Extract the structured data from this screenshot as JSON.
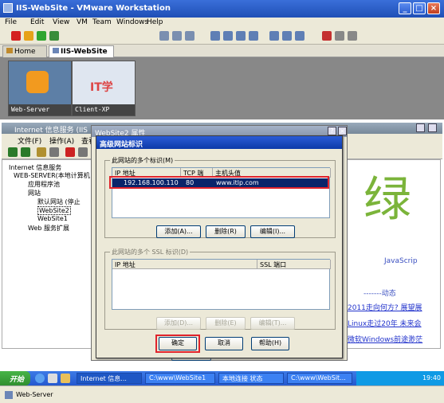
{
  "vmware": {
    "title": "IIS-WebSite - VMware Workstation",
    "menu": [
      "File",
      "Edit",
      "View",
      "VM",
      "Team",
      "Windows",
      "Help"
    ],
    "tabs": [
      "Home",
      "IIS-WebSite"
    ],
    "thumbnails": [
      "Web-Server",
      "Client-XP"
    ],
    "thumbnail_logo_text": "IT学"
  },
  "iis": {
    "title": "Internet 信息服务 (IIS",
    "menu": [
      "文件(F)",
      "操作(A)",
      "查看"
    ],
    "tree": {
      "root": "Internet 信息服务",
      "server": "WEB-SERVER(本地计算机",
      "apppool": "应用程序池",
      "websites": "网站",
      "default_site": "默认网站 (停止",
      "site2": "WebSite2",
      "site1": "WebSite1",
      "web_ext": "Web 服务扩展"
    }
  },
  "props_dialog": {
    "title": "WebSite2 属性",
    "ok_label": "确定"
  },
  "adv_dialog": {
    "title": "高级网站标识",
    "group1_label": "此网站的多个标识(M)",
    "col_ip": "IP 地址",
    "col_port": "TCP 端口",
    "col_host": "主机头值",
    "binding": {
      "ip": "192.168.100.110",
      "port": "80",
      "host": "www.itlp.com"
    },
    "add1": "添加(A)...",
    "remove1": "删除(R)",
    "edit1": "编辑(I)...",
    "group2_label": "此网站的多个 SSL 标识(D)",
    "col_ssl_ip": "IP 地址",
    "col_ssl_port": "SSL 端口",
    "add2": "添加(D)...",
    "remove2": "删除(E)",
    "edit2": "编辑(T)...",
    "ok": "确定",
    "cancel": "取消",
    "help": "帮助(H)"
  },
  "web_content": {
    "big_char": "绿",
    "js_label": "JavaScrip",
    "dyn_label": "-------动态",
    "line1": "2011走向何方? 展望展",
    "line2": "Linux走过20年 未来会",
    "line3": "微软Windows前途渺茫"
  },
  "taskbar": {
    "start": "开始",
    "tasks": [
      "Internet 信息...",
      "C:\\www\\WebSite1",
      "本地连接 状态",
      "C:\\www\\WebSit..."
    ],
    "time": "19:40"
  },
  "statusbar": {
    "vm_label": "Web-Server"
  },
  "colors": {
    "highlight_red": "#e0232b",
    "title_blue": "#0c3aa8"
  }
}
